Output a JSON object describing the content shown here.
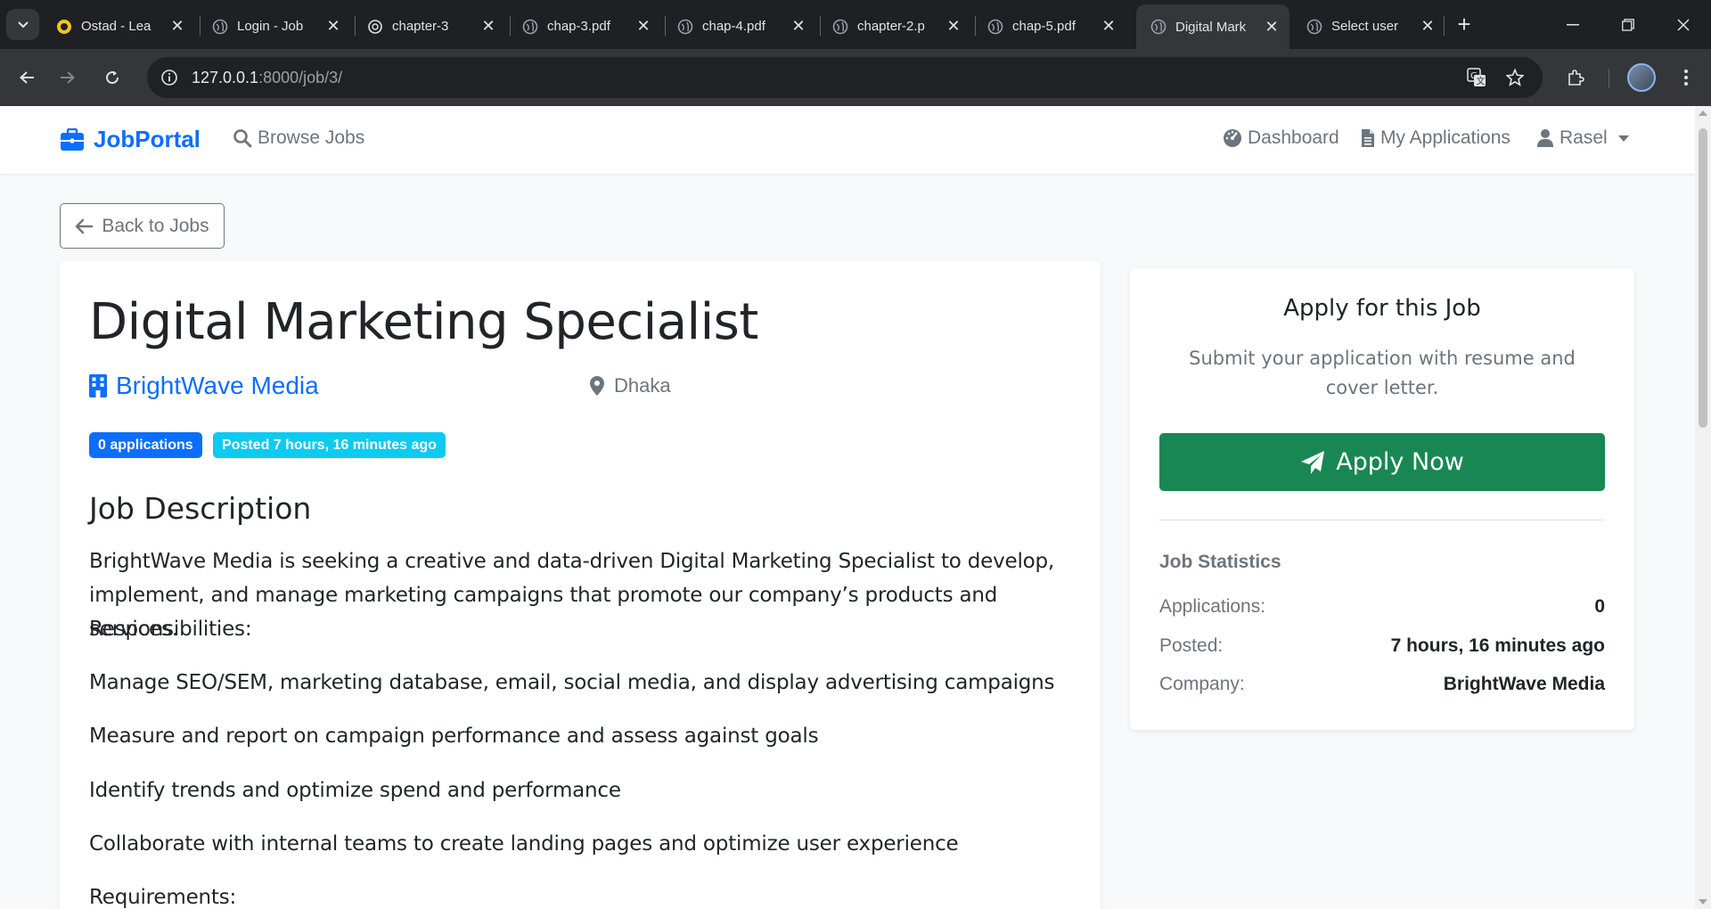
{
  "browser": {
    "tabs": [
      {
        "title": "Ostad - Lea",
        "active": false
      },
      {
        "title": "Login - Job",
        "active": false
      },
      {
        "title": "chapter-3",
        "active": false
      },
      {
        "title": "chap-3.pdf",
        "active": false
      },
      {
        "title": "chap-4.pdf",
        "active": false
      },
      {
        "title": "chapter-2.p",
        "active": false
      },
      {
        "title": "chap-5.pdf",
        "active": false
      },
      {
        "title": "Digital Mark",
        "active": true
      },
      {
        "title": "Select user",
        "active": false
      }
    ],
    "url_host": "127.0.0.1",
    "url_rest": ":8000/job/3/"
  },
  "navbar": {
    "brand": "JobPortal",
    "browse": "Browse Jobs",
    "dashboard": "Dashboard",
    "applications": "My Applications",
    "user": "Rasel"
  },
  "back_label": "Back to Jobs",
  "job": {
    "title": "Digital Marketing Specialist",
    "company": "BrightWave Media",
    "location": "Dhaka",
    "badge_applications": "0 applications",
    "badge_posted": "Posted 7 hours, 16 minutes ago",
    "description_heading": "Job Description",
    "paragraphs": [
      "BrightWave Media is seeking a creative and data-driven Digital Marketing Specialist to develop, implement, and manage marketing campaigns that promote our company’s products and services.",
      "Responsibilities:",
      "Manage SEO/SEM, marketing database, email, social media, and display advertising campaigns",
      "Measure and report on campaign performance and assess against goals",
      "Identify trends and optimize spend and performance",
      "Collaborate with internal teams to create landing pages and optimize user experience",
      "Requirements:"
    ]
  },
  "apply": {
    "title": "Apply for this Job",
    "subtitle": "Submit your application with resume and cover letter.",
    "button": "Apply Now",
    "stats_heading": "Job Statistics",
    "stats": [
      {
        "key": "Applications:",
        "value": "0"
      },
      {
        "key": "Posted:",
        "value": "7 hours, 16 minutes ago"
      },
      {
        "key": "Company:",
        "value": "BrightWave Media"
      }
    ]
  },
  "colors": {
    "primary": "#0d6efd",
    "success": "#198754",
    "info": "#0dcaf0",
    "muted": "#6c757d"
  }
}
